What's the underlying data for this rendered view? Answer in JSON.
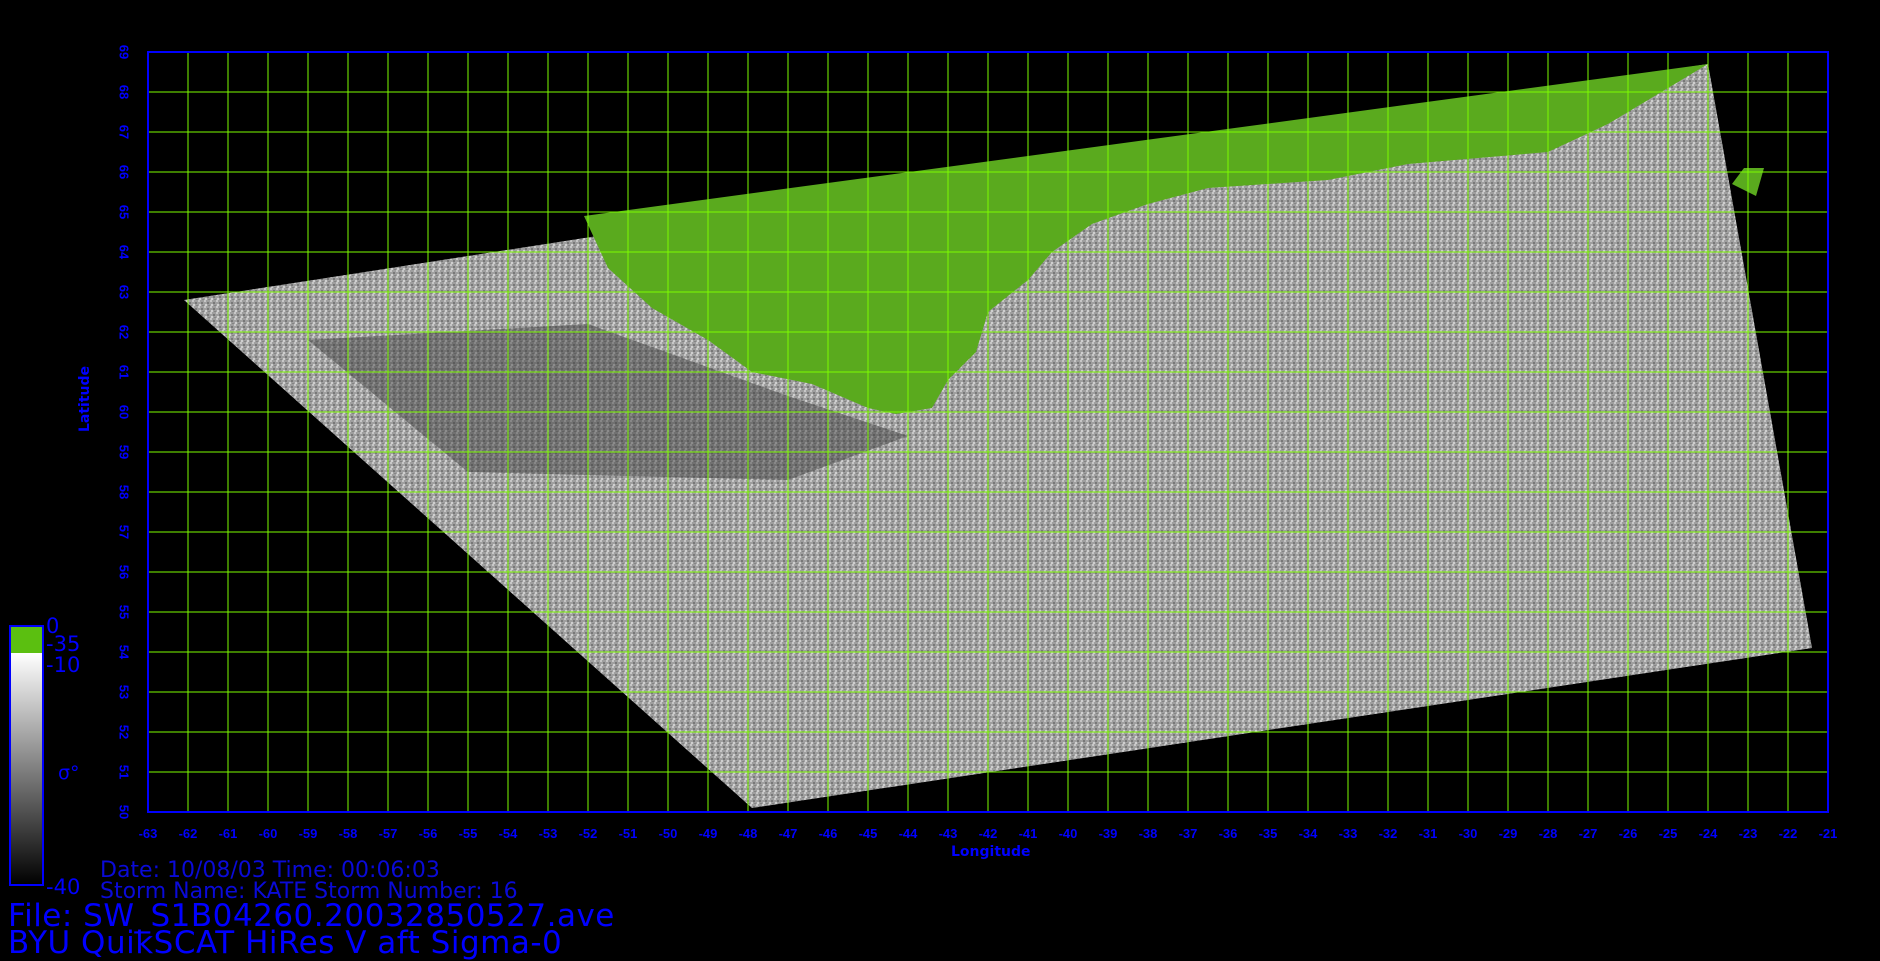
{
  "map": {
    "lon_range": [
      -63,
      -21
    ],
    "lat_range": [
      50,
      69
    ],
    "lon_ticks": [
      "-63",
      "-62",
      "-61",
      "-60",
      "-59",
      "-58",
      "-57",
      "-56",
      "-55",
      "-54",
      "-53",
      "-52",
      "-51",
      "-50",
      "-49",
      "-48",
      "-47",
      "-46",
      "-45",
      "-44",
      "-43",
      "-42",
      "-41",
      "-40",
      "-39",
      "-38",
      "-37",
      "-36",
      "-35",
      "-34",
      "-33",
      "-32",
      "-31",
      "-30",
      "-29",
      "-28",
      "-27",
      "-26",
      "-25",
      "-24",
      "-23",
      "-22",
      "-21"
    ],
    "lat_ticks": [
      "50",
      "51",
      "52",
      "53",
      "54",
      "55",
      "56",
      "57",
      "58",
      "59",
      "60",
      "61",
      "62",
      "63",
      "64",
      "65",
      "66",
      "67",
      "68",
      "69"
    ],
    "xlabel": "Longitude",
    "ylabel": "Latitude",
    "grid": true,
    "grid_color": "#7cfc00",
    "axis_color": "#0000ff",
    "swath_corners_lonlat": [
      [
        -62.1,
        62.8
      ],
      [
        -24.0,
        68.7
      ],
      [
        -21.4,
        54.1
      ],
      [
        -47.9,
        50.1
      ]
    ],
    "land_region": "green area (Greenland) in upper portion of swath",
    "land_color": "#5aaa1e",
    "ocean_color": "#a8a8a8"
  },
  "colorbar": {
    "labels": {
      "top": "0",
      "land": "-35",
      "upper": "-10",
      "symbol": "σ°",
      "bottom": "-40"
    },
    "land_color": "#5bbf10",
    "gradient": [
      "#ffffff",
      "#000000"
    ]
  },
  "info": {
    "line1": "Date:  10/08/03   Time:  00:06:03",
    "line2": "Storm  Name:  KATE   Storm  Number:  16"
  },
  "footer": {
    "file": "File:  SW_S1B04260.20032850527.ave",
    "product": "BYU  QuikSCAT  HiRes  V  aft  Sigma-0"
  }
}
